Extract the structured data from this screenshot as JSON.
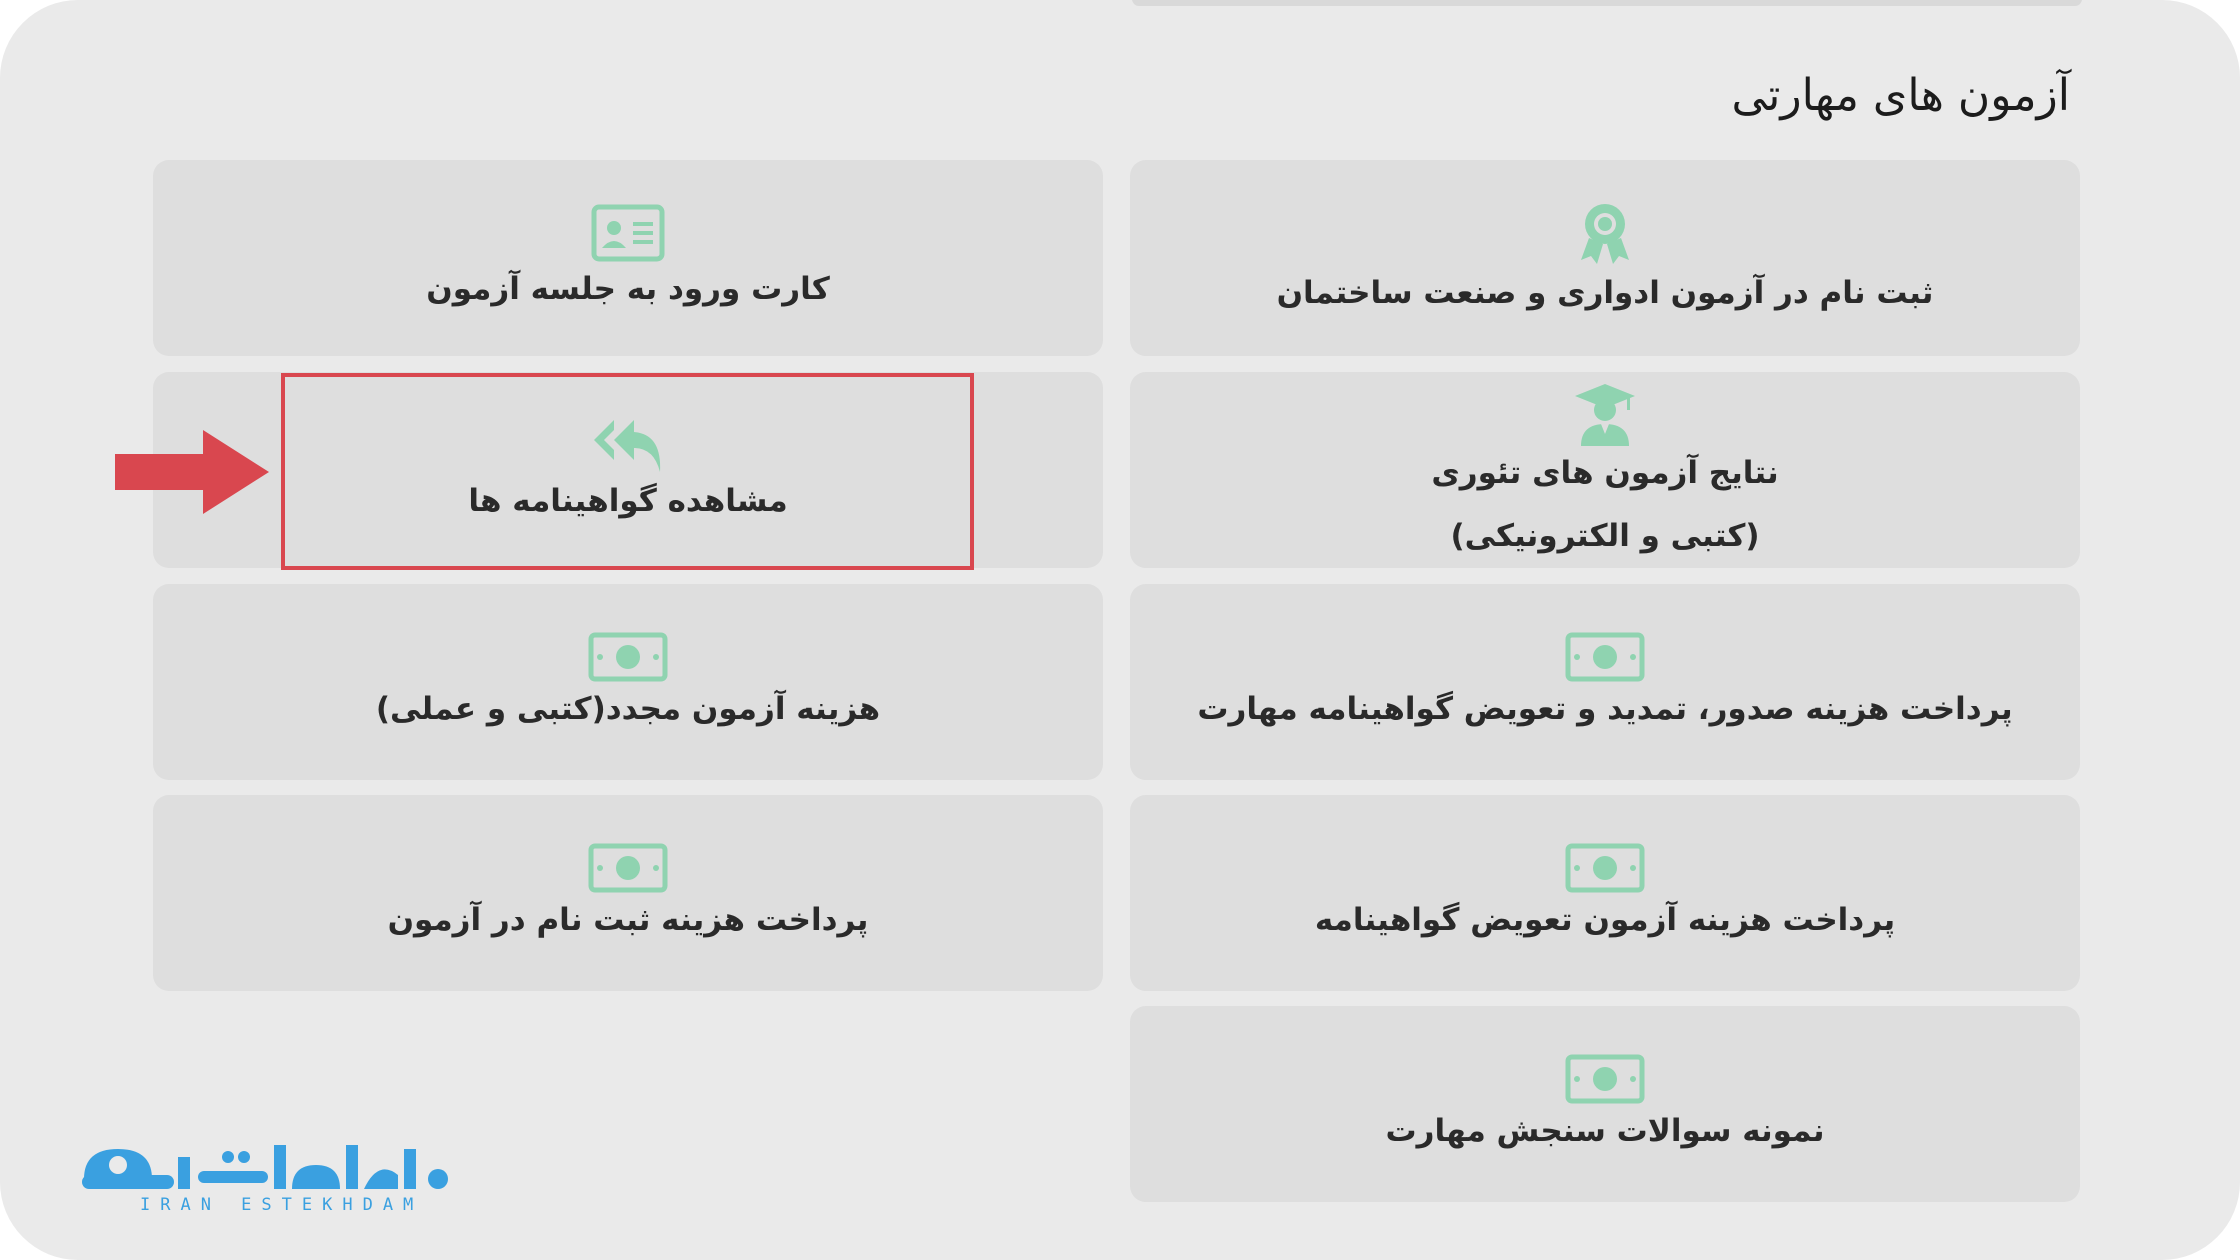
{
  "section": {
    "title": "آزمون های مهارتی"
  },
  "cards": {
    "register_exam": {
      "label": "ثبت نام در آزمون ادواری و صنعت ساختمان",
      "icon": "award-ribbon-icon"
    },
    "entry_card": {
      "label": "کارت ورود به جلسه آزمون",
      "icon": "id-card-icon"
    },
    "theory_results": {
      "label": "نتایج آزمون های تئوری",
      "label2": "(کتبی و الکترونیکی)",
      "icon": "graduate-icon"
    },
    "view_certificates": {
      "label": "مشاهده گواهینامه ها",
      "icon": "reply-all-icon"
    },
    "pay_issue_fee": {
      "label": "پرداخت هزینه صدور، تمدید و تعویض گواهینامه مهارت",
      "icon": "money-icon"
    },
    "retake_fee": {
      "label": "هزینه آزمون مجدد(کتبی و عملی)",
      "icon": "money-icon"
    },
    "pay_exchange_fee": {
      "label": "پرداخت هزینه آزمون تعویض گواهینامه",
      "icon": "money-icon"
    },
    "pay_registration_fee": {
      "label": "پرداخت هزینه ثبت نام در آزمون",
      "icon": "money-icon"
    },
    "sample_questions": {
      "label": "نمونه سوالات سنجش مهارت",
      "icon": "money-icon"
    }
  },
  "annotation": {
    "highlight_color": "#d9474f",
    "arrow_color": "#d9474f",
    "highlight_target": "view_certificates"
  },
  "logo": {
    "text": "ایران استخدام",
    "subtitle": "IRAN ESTEKHDAM",
    "color": "#3aa0e0"
  },
  "colors": {
    "icon": "#8fd3b0",
    "card_bg": "#dedede",
    "page_bg": "#eaeaea"
  }
}
